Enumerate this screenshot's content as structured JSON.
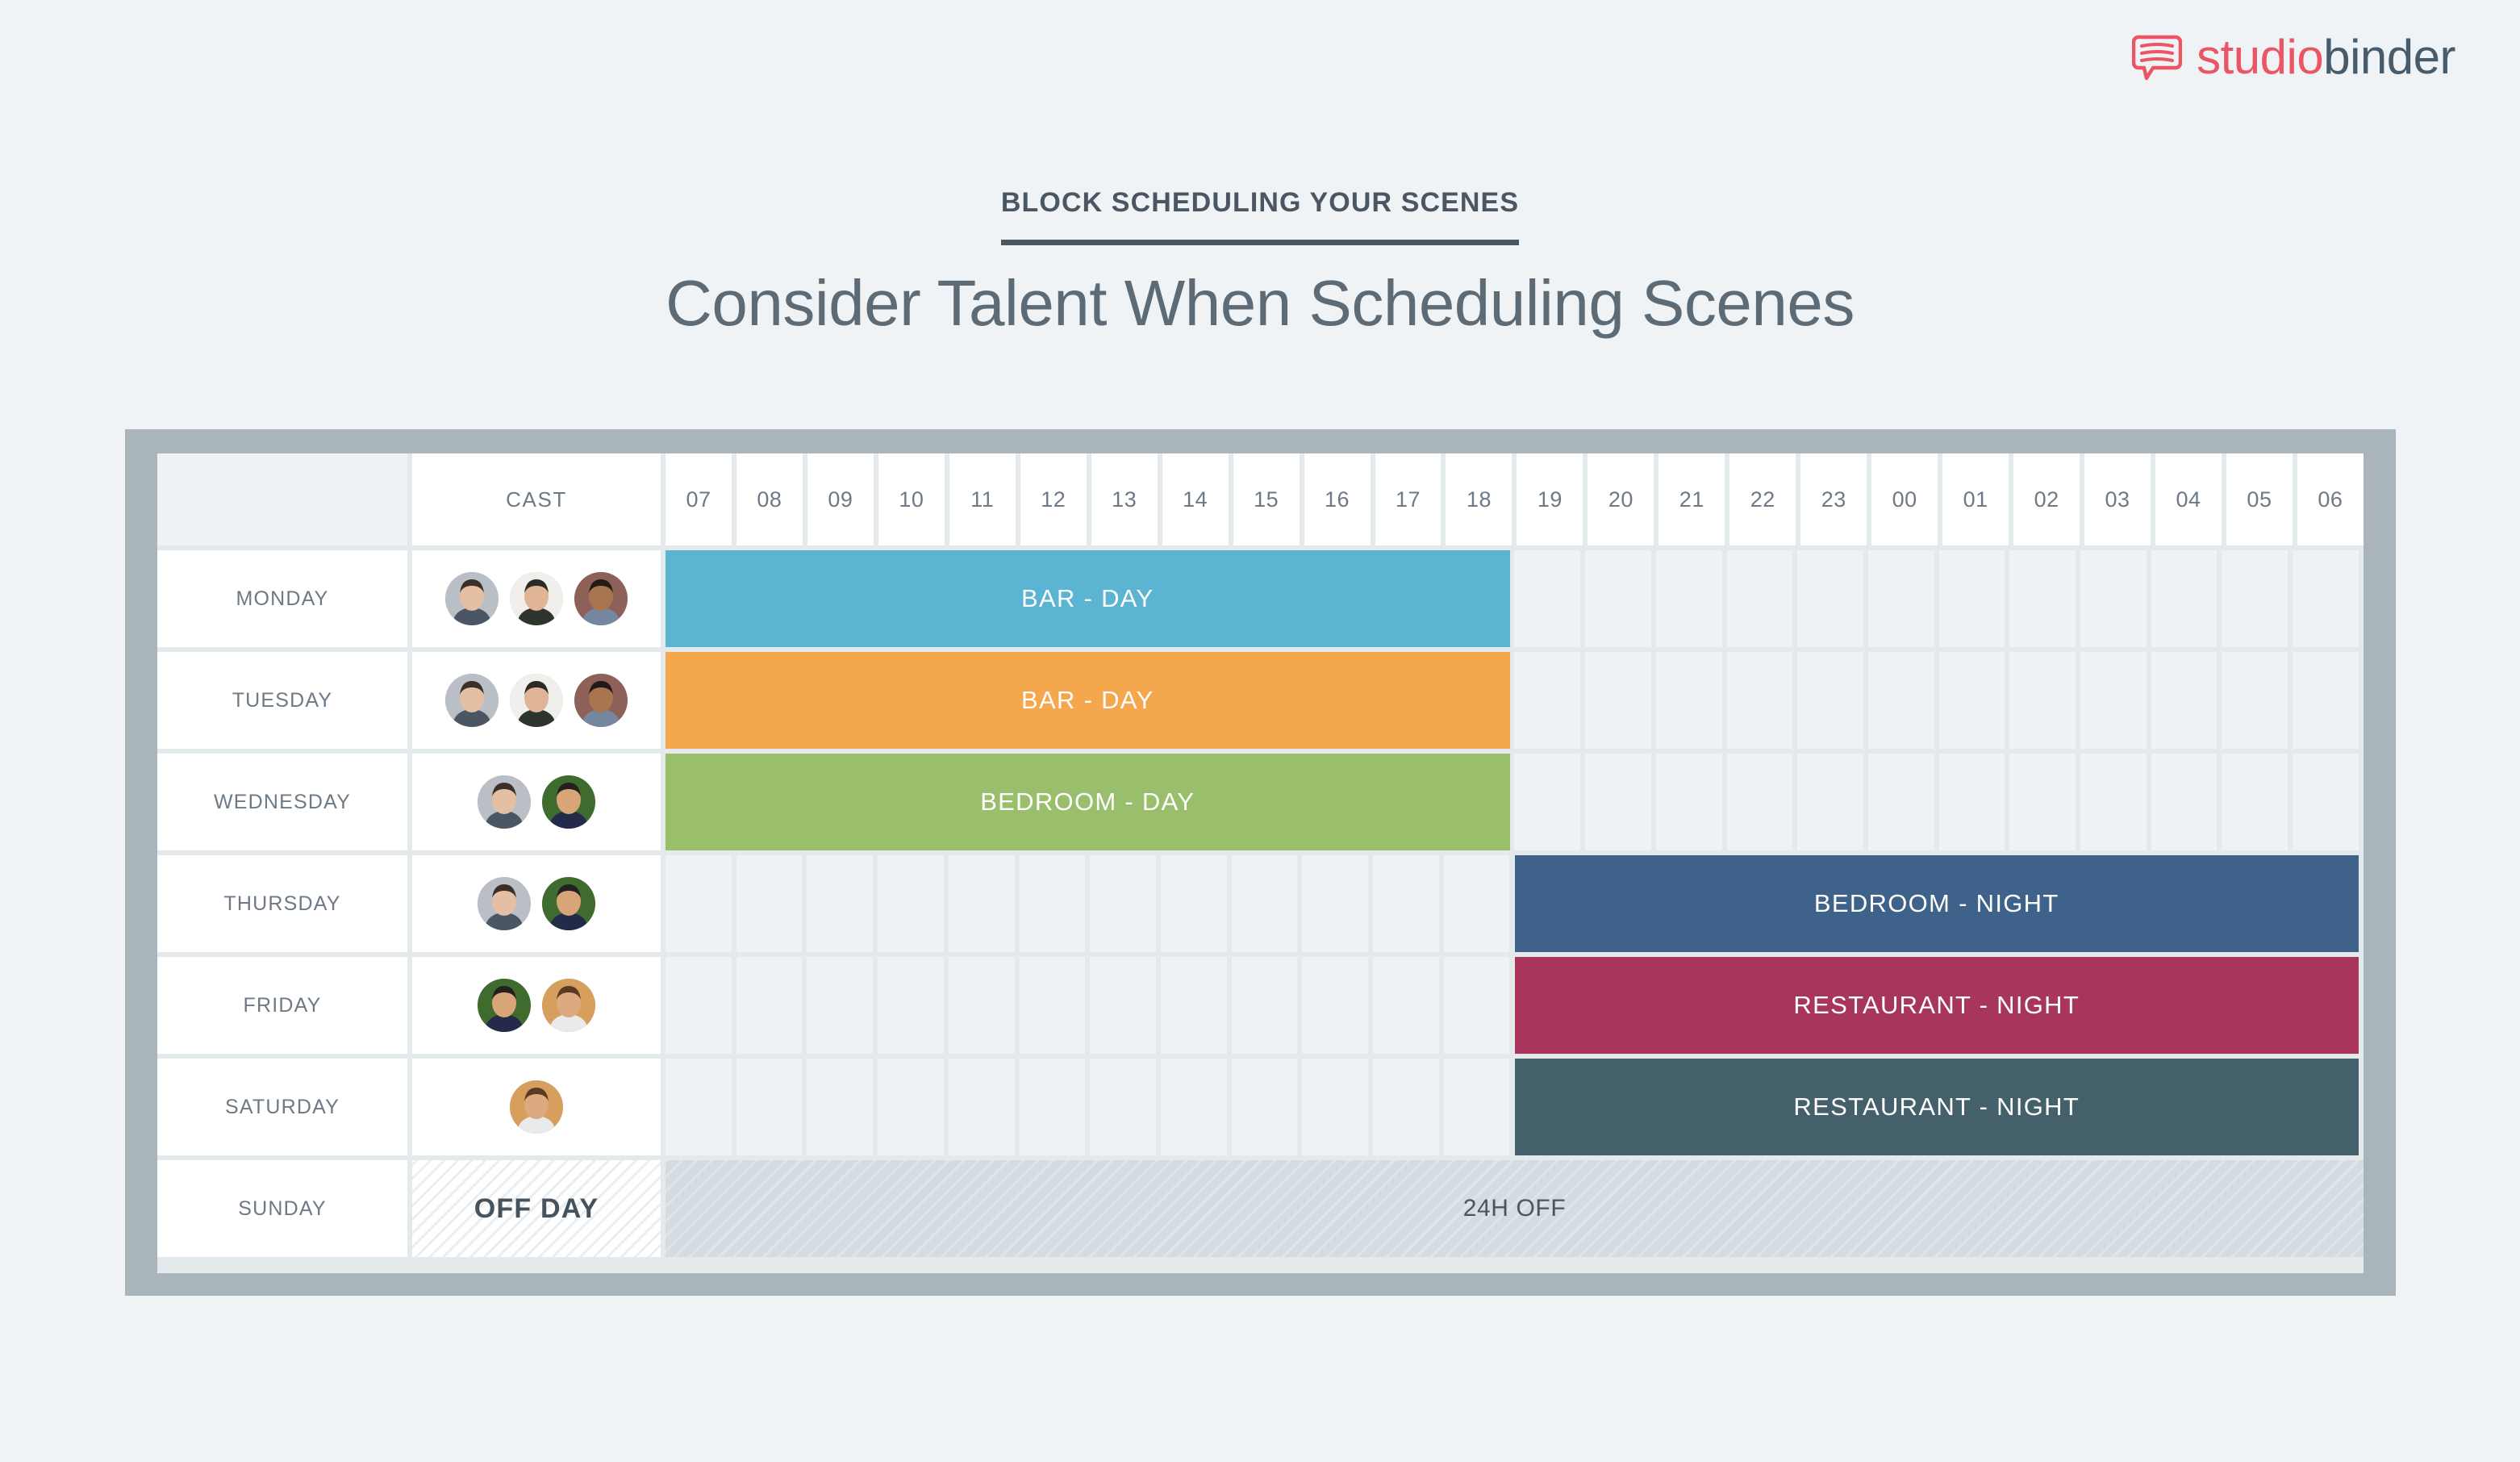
{
  "brand": {
    "logo_icon": "speech-bubble-lines-icon",
    "name_part1": "studio",
    "name_part2": "binder",
    "color_accent": "#ec5564",
    "color_dark": "#465b6b"
  },
  "heading": {
    "eyebrow": "BLOCK SCHEDULING YOUR SCENES",
    "title": "Consider Talent When Scheduling Scenes"
  },
  "schedule": {
    "columns": {
      "day_header": "",
      "cast_header": "CAST",
      "hours": [
        "07",
        "08",
        "09",
        "10",
        "11",
        "12",
        "13",
        "14",
        "15",
        "16",
        "17",
        "18",
        "19",
        "20",
        "21",
        "22",
        "23",
        "00",
        "01",
        "02",
        "03",
        "04",
        "05",
        "06"
      ]
    },
    "rows": [
      {
        "day": "MONDAY",
        "cast": [
          {
            "name": "actor-young-man-gray-bg",
            "skin": "#e4bfa4",
            "hair": "#3b3029",
            "bg": "#b9bfc4",
            "shirt": "#4a5663"
          },
          {
            "name": "actor-bearded-sunglasses",
            "skin": "#e0b496",
            "hair": "#2c2a26",
            "bg": "#f0efeb",
            "shirt": "#2e352c"
          },
          {
            "name": "actor-denim-shirt-pattern-bg",
            "skin": "#a9754e",
            "hair": "#211a16",
            "bg": "#8d6158",
            "shirt": "#74879e"
          }
        ],
        "event": {
          "label": "BAR - DAY",
          "color": "#5cb4d3",
          "start_hour": "07",
          "end_hour": "18"
        },
        "off": false
      },
      {
        "day": "TUESDAY",
        "cast": [
          {
            "name": "actor-young-man-gray-bg",
            "skin": "#e4bfa4",
            "hair": "#3b3029",
            "bg": "#b9bfc4",
            "shirt": "#4a5663"
          },
          {
            "name": "actor-bearded-sunglasses",
            "skin": "#e0b496",
            "hair": "#2c2a26",
            "bg": "#f0efeb",
            "shirt": "#2e352c"
          },
          {
            "name": "actor-denim-shirt-pattern-bg",
            "skin": "#a9754e",
            "hair": "#211a16",
            "bg": "#8d6158",
            "shirt": "#74879e"
          }
        ],
        "event": {
          "label": "BAR - DAY",
          "color": "#f4a74c",
          "start_hour": "07",
          "end_hour": "18"
        },
        "off": false
      },
      {
        "day": "WEDNESDAY",
        "cast": [
          {
            "name": "actor-young-man-gray-bg",
            "skin": "#e4bfa4",
            "hair": "#3b3029",
            "bg": "#b9bfc4",
            "shirt": "#4a5663"
          },
          {
            "name": "actor-hoodie-green-bg",
            "skin": "#d8a579",
            "hair": "#23211f",
            "bg": "#3f6b2f",
            "shirt": "#242a4a"
          }
        ],
        "event": {
          "label": "BEDROOM - DAY",
          "color": "#99bf6c",
          "start_hour": "07",
          "end_hour": "18"
        },
        "off": false
      },
      {
        "day": "THURSDAY",
        "cast": [
          {
            "name": "actor-young-man-gray-bg",
            "skin": "#e4bfa4",
            "hair": "#3b3029",
            "bg": "#b9bfc4",
            "shirt": "#4a5663"
          },
          {
            "name": "actor-hoodie-green-bg",
            "skin": "#d8a579",
            "hair": "#23211f",
            "bg": "#3f6b2f",
            "shirt": "#242a4a"
          }
        ],
        "event": {
          "label": "BEDROOM - NIGHT",
          "color": "#3e6289",
          "start_hour": "19",
          "end_hour": "06"
        },
        "off": false
      },
      {
        "day": "FRIDAY",
        "cast": [
          {
            "name": "actor-hoodie-green-bg",
            "skin": "#d8a579",
            "hair": "#23211f",
            "bg": "#3f6b2f",
            "shirt": "#242a4a"
          },
          {
            "name": "actor-astronaut-helmet",
            "skin": "#dda97f",
            "hair": "#5b3a24",
            "bg": "#d79f5e",
            "shirt": "#e8eaec"
          }
        ],
        "event": {
          "label": "RESTAURANT - NIGHT",
          "color": "#a8355b",
          "start_hour": "19",
          "end_hour": "06"
        },
        "off": false
      },
      {
        "day": "SATURDAY",
        "cast": [
          {
            "name": "actor-astronaut-helmet",
            "skin": "#dda97f",
            "hair": "#5b3a24",
            "bg": "#d79f5e",
            "shirt": "#e8eaec"
          }
        ],
        "event": {
          "label": "RESTAURANT - NIGHT",
          "color": "#44606a",
          "start_hour": "19",
          "end_hour": "06"
        },
        "off": false
      },
      {
        "day": "SUNDAY",
        "cast": [],
        "cast_label": "OFF DAY",
        "event": null,
        "off": true,
        "off_label": "24H OFF"
      }
    ]
  },
  "colors": {
    "frame": "#a9b4bb",
    "board": "#e4e9ec",
    "page_bg": "#eff3f5",
    "cell_empty": "#eef2f4",
    "cell_white": "#ffffff",
    "text_muted": "#6d7a85"
  }
}
